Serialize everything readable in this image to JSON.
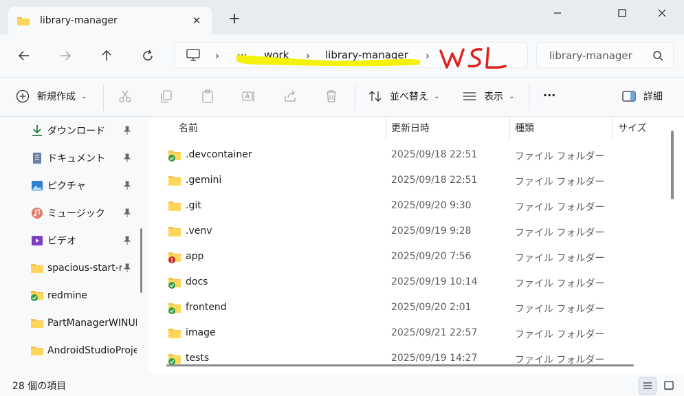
{
  "tab": {
    "title": "library-manager",
    "close": "✕",
    "new_tab": "+"
  },
  "window": {
    "minimize": "—",
    "maximize": "□",
    "close": "✕"
  },
  "address": {
    "ellipsis": "···",
    "crumbs": [
      "work",
      "library-manager"
    ],
    "annotation": "WSL",
    "highlight_color": "#f5ef00",
    "annotation_color": "#e0201e"
  },
  "search": {
    "placeholder": "library-manager"
  },
  "toolbar": {
    "new_label": "新規作成",
    "sort_label": "並べ替え",
    "view_label": "表示",
    "more_label": "···",
    "details_label": "詳細"
  },
  "sidebar": {
    "items": [
      {
        "label": "ダウンロード",
        "icon": "download-icon",
        "pinned": true
      },
      {
        "label": "ドキュメント",
        "icon": "documents-icon",
        "pinned": true
      },
      {
        "label": "ピクチャ",
        "icon": "pictures-icon",
        "pinned": true
      },
      {
        "label": "ミュージック",
        "icon": "music-icon",
        "pinned": true
      },
      {
        "label": "ビデオ",
        "icon": "videos-icon",
        "pinned": true
      },
      {
        "label": "spacious-start-m",
        "icon": "folder-icon",
        "pinned": true
      },
      {
        "label": "redmine",
        "icon": "folder-synced-icon",
        "pinned": false
      },
      {
        "label": "PartManagerWINUI",
        "icon": "folder-icon",
        "pinned": false
      },
      {
        "label": "AndroidStudioProje",
        "icon": "folder-icon",
        "pinned": false
      }
    ]
  },
  "columns": {
    "name": "名前",
    "modified": "更新日時",
    "type": "種類",
    "size": "サイズ",
    "sort_indicator": "⌃"
  },
  "files": [
    {
      "name": ".devcontainer",
      "date": "2025/09/18 22:51",
      "type": "ファイル フォルダー",
      "status": "synced"
    },
    {
      "name": ".gemini",
      "date": "2025/09/18 22:51",
      "type": "ファイル フォルダー",
      "status": "none"
    },
    {
      "name": ".git",
      "date": "2025/09/20 9:30",
      "type": "ファイル フォルダー",
      "status": "none"
    },
    {
      "name": ".venv",
      "date": "2025/09/19 9:28",
      "type": "ファイル フォルダー",
      "status": "none"
    },
    {
      "name": "app",
      "date": "2025/09/20 7:56",
      "type": "ファイル フォルダー",
      "status": "error"
    },
    {
      "name": "docs",
      "date": "2025/09/19 10:14",
      "type": "ファイル フォルダー",
      "status": "synced"
    },
    {
      "name": "frontend",
      "date": "2025/09/20 2:01",
      "type": "ファイル フォルダー",
      "status": "synced"
    },
    {
      "name": "image",
      "date": "2025/09/21 22:57",
      "type": "ファイル フォルダー",
      "status": "none"
    },
    {
      "name": "tests",
      "date": "2025/09/19 14:27",
      "type": "ファイル フォルダー",
      "status": "synced"
    }
  ],
  "status": {
    "count": "28 個の項目"
  }
}
